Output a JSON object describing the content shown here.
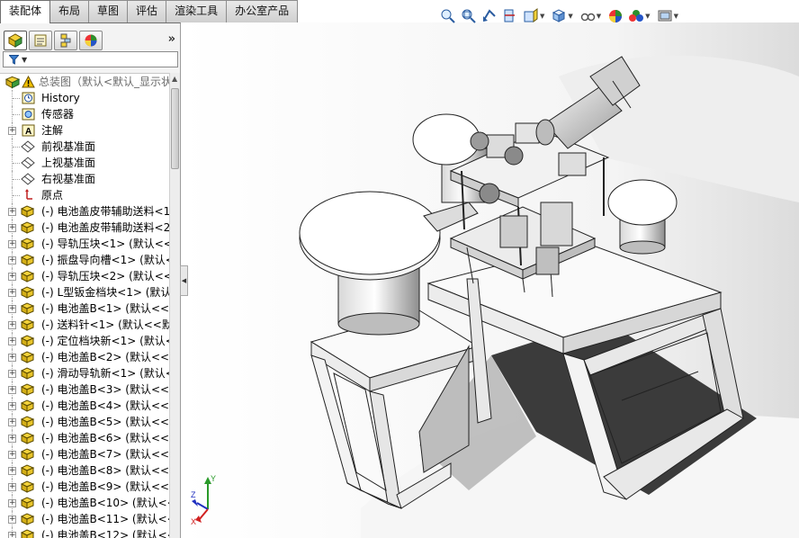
{
  "window": {
    "tabs": [
      {
        "label": "装配体",
        "active": true
      },
      {
        "label": "布局",
        "active": false
      },
      {
        "label": "草图",
        "active": false
      },
      {
        "label": "评估",
        "active": false
      },
      {
        "label": "渲染工具",
        "active": false
      },
      {
        "label": "办公室产品",
        "active": false
      }
    ]
  },
  "panel": {
    "tabs": [
      {
        "icon": "feature-manager-icon"
      },
      {
        "icon": "property-manager-icon"
      },
      {
        "icon": "configuration-manager-icon"
      },
      {
        "icon": "display-manager-icon"
      }
    ],
    "chevron": "»",
    "filter_icon": "filter-icon"
  },
  "tree": {
    "root": {
      "label": "总装图（默认<默认_显示状",
      "icon": "assembly-icon",
      "warning_icon": "warning-icon"
    },
    "items": [
      {
        "label": "History",
        "icon": "history-icon",
        "expandable": false
      },
      {
        "label": "传感器",
        "icon": "sensor-icon",
        "expandable": false
      },
      {
        "label": "注解",
        "icon": "annotation-icon",
        "expandable": true
      },
      {
        "label": "前视基准面",
        "icon": "plane-icon",
        "expandable": false
      },
      {
        "label": "上视基准面",
        "icon": "plane-icon",
        "expandable": false
      },
      {
        "label": "右视基准面",
        "icon": "plane-icon",
        "expandable": false
      },
      {
        "label": "原点",
        "icon": "origin-icon",
        "expandable": false
      },
      {
        "label": "(-) 电池盖皮带辅助送料<1",
        "icon": "part-icon",
        "expandable": true
      },
      {
        "label": "(-) 电池盖皮带辅助送料<2",
        "icon": "part-icon",
        "expandable": true
      },
      {
        "label": "(-) 导轨压块<1> (默认<<",
        "icon": "part-icon",
        "expandable": true
      },
      {
        "label": "(-) 振盘导向槽<1> (默认<",
        "icon": "part-icon",
        "expandable": true
      },
      {
        "label": "(-) 导轨压块<2> (默认<<",
        "icon": "part-icon",
        "expandable": true
      },
      {
        "label": "(-) L型钣金档块<1> (默认",
        "icon": "part-icon",
        "expandable": true
      },
      {
        "label": "(-) 电池盖B<1> (默认<<",
        "icon": "part-icon",
        "expandable": true
      },
      {
        "label": "(-) 送料针<1> (默认<<默",
        "icon": "part-icon",
        "expandable": true
      },
      {
        "label": "(-) 定位档块新<1> (默认<",
        "icon": "part-icon",
        "expandable": true
      },
      {
        "label": "(-) 电池盖B<2> (默认<<",
        "icon": "part-icon",
        "expandable": true
      },
      {
        "label": "(-) 滑动导轨新<1> (默认<",
        "icon": "part-icon",
        "expandable": true
      },
      {
        "label": "(-) 电池盖B<3> (默认<<",
        "icon": "part-icon",
        "expandable": true
      },
      {
        "label": "(-) 电池盖B<4> (默认<<",
        "icon": "part-icon",
        "expandable": true
      },
      {
        "label": "(-) 电池盖B<5> (默认<<",
        "icon": "part-icon",
        "expandable": true
      },
      {
        "label": "(-) 电池盖B<6> (默认<<",
        "icon": "part-icon",
        "expandable": true
      },
      {
        "label": "(-) 电池盖B<7> (默认<<",
        "icon": "part-icon",
        "expandable": true
      },
      {
        "label": "(-) 电池盖B<8> (默认<<",
        "icon": "part-icon",
        "expandable": true
      },
      {
        "label": "(-) 电池盖B<9> (默认<<",
        "icon": "part-icon",
        "expandable": true
      },
      {
        "label": "(-) 电池盖B<10> (默认<<",
        "icon": "part-icon",
        "expandable": true
      },
      {
        "label": "(-) 电池盖B<11> (默认<<",
        "icon": "part-icon",
        "expandable": true
      },
      {
        "label": "(-) 电池盖B<12> (默认<<",
        "icon": "part-icon",
        "expandable": true
      }
    ]
  },
  "hud_toolbar": [
    {
      "icon": "zoom-to-fit-icon",
      "dropdown": false
    },
    {
      "icon": "zoom-to-area-icon",
      "dropdown": false
    },
    {
      "icon": "previous-view-icon",
      "dropdown": false
    },
    {
      "icon": "section-view-icon",
      "dropdown": false
    },
    {
      "icon": "view-orientation-icon",
      "dropdown": true
    },
    {
      "icon": "display-style-icon",
      "dropdown": true
    },
    {
      "icon": "hide-show-items-icon",
      "dropdown": true
    },
    {
      "icon": "edit-appearance-icon",
      "dropdown": false
    },
    {
      "icon": "apply-scene-icon",
      "dropdown": true
    },
    {
      "icon": "view-settings-icon",
      "dropdown": true
    }
  ],
  "triad": {
    "x": "X",
    "y": "Y",
    "z": "Z"
  },
  "colors": {
    "x_axis": "#d02020",
    "y_axis": "#2a9a2a",
    "z_axis": "#2030c0",
    "part": "#e6c200",
    "warning": "#f0c000"
  }
}
